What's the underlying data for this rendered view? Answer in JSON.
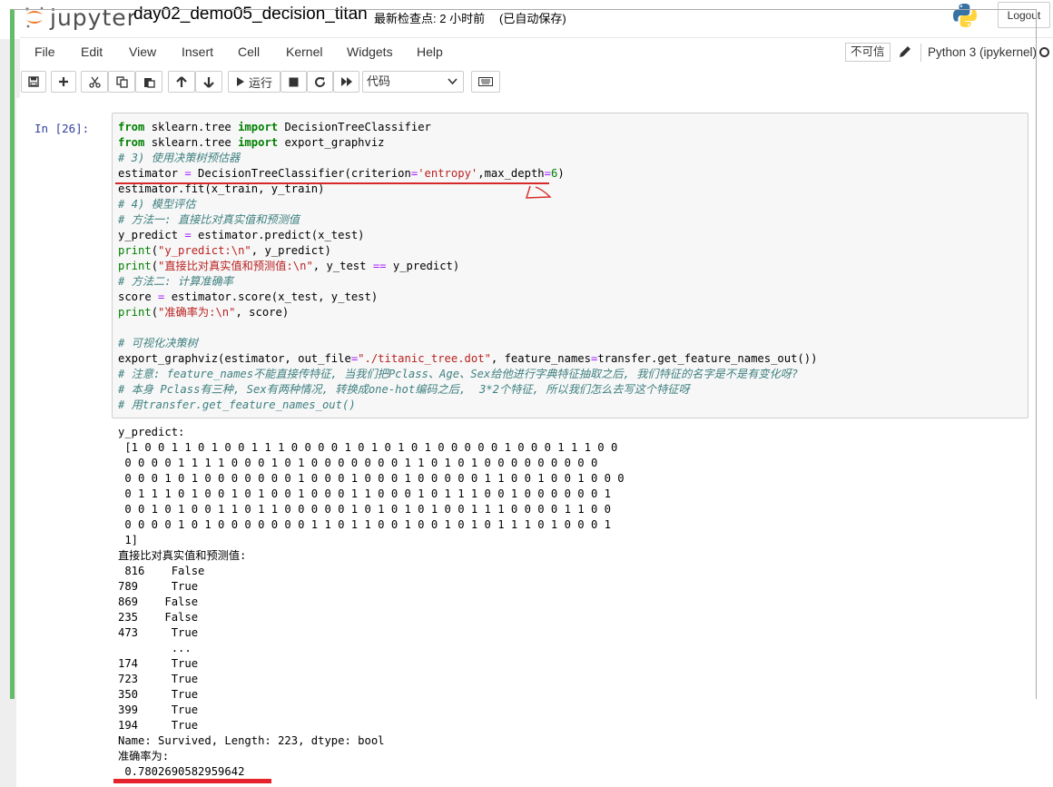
{
  "header": {
    "logo_text": "jupyter",
    "notebook_name": "day02_demo05_decision_titan",
    "checkpoint": "最新检查点: 2 小时前",
    "autosave": "(已自动保存)",
    "logout_label": "Logout"
  },
  "menu": {
    "items": [
      "File",
      "Edit",
      "View",
      "Insert",
      "Cell",
      "Kernel",
      "Widgets",
      "Help"
    ],
    "trust_label": "不可信",
    "kernel_name": "Python 3 (ipykernel)"
  },
  "toolbar": {
    "run_label": "运行",
    "cell_type": "代码"
  },
  "cell": {
    "prompt": "In  [26]:",
    "code": [
      "from sklearn.tree import DecisionTreeClassifier",
      "from sklearn.tree import export_graphviz",
      "# 3) 使用决策树预估器",
      "estimator = DecisionTreeClassifier(criterion='entropy',max_depth=6)",
      "estimator.fit(x_train, y_train)",
      "# 4) 模型评估",
      "# 方法一: 直接比对真实值和预测值",
      "y_predict = estimator.predict(x_test)",
      "print(\"y_predict:\\n\", y_predict)",
      "print(\"直接比对真实值和预测值:\\n\", y_test == y_predict)",
      "# 方法二: 计算准确率",
      "score = estimator.score(x_test, y_test)",
      "print(\"准确率为:\\n\", score)",
      "",
      "# 可视化决策树",
      "export_graphviz(estimator, out_file=\"./titanic_tree.dot\", feature_names=transfer.get_feature_names_out())",
      "# 注意: feature_names不能直接传特征, 当我们把Pclass、Age、Sex给他进行字典特征抽取之后, 我们特征的名字是不是有变化呀?",
      "# 本身 Pclass有三种, Sex有两种情况, 转换成one-hot编码之后,  3*2个特征, 所以我们怎么去写这个特征呀",
      "# 用transfer.get_feature_names_out()"
    ],
    "output": [
      "y_predict:",
      " [1 0 0 1 1 0 1 0 0 1 1 1 0 0 0 0 1 0 1 0 1 0 1 0 0 0 0 0 1 0 0 0 1 1 1 0 0",
      " 0 0 0 0 1 1 1 1 0 0 0 1 0 1 0 0 0 0 0 0 0 1 1 0 1 0 1 0 0 0 0 0 0 0 0 0",
      " 0 0 0 1 0 1 0 0 0 0 0 0 0 1 0 0 0 1 0 0 0 1 0 0 0 0 0 1 1 0 0 1 0 0 1 0 0 0",
      " 0 1 1 1 0 1 0 0 1 0 1 0 0 1 0 0 0 1 1 0 0 0 1 0 1 1 1 0 0 1 0 0 0 0 0 0 1",
      " 0 0 1 0 1 0 0 1 1 0 1 1 0 0 0 0 0 1 0 1 0 1 0 1 0 0 1 1 1 0 0 0 0 1 1 0 0",
      " 0 0 0 0 1 0 1 0 0 0 0 0 0 0 1 1 0 1 1 0 0 1 0 0 1 0 1 0 1 1 1 0 1 0 0 0 1",
      " 1]",
      "直接比对真实值和预测值:",
      " 816    False",
      "789     True",
      "869    False",
      "235    False",
      "473     True",
      "        ...",
      "174     True",
      "723     True",
      "350     True",
      "399     True",
      "194     True",
      "Name: Survived, Length: 223, dtype: bool",
      "准确率为:",
      " 0.7802690582959642"
    ]
  },
  "icons": [
    "save-icon",
    "plus-icon",
    "cut-icon",
    "copy-icon",
    "paste-icon",
    "arrow-up-icon",
    "arrow-down-icon",
    "run-icon",
    "stop-icon",
    "restart-icon",
    "fast-forward-icon",
    "keyboard-icon",
    "pencil-icon",
    "python-logo-icon"
  ]
}
